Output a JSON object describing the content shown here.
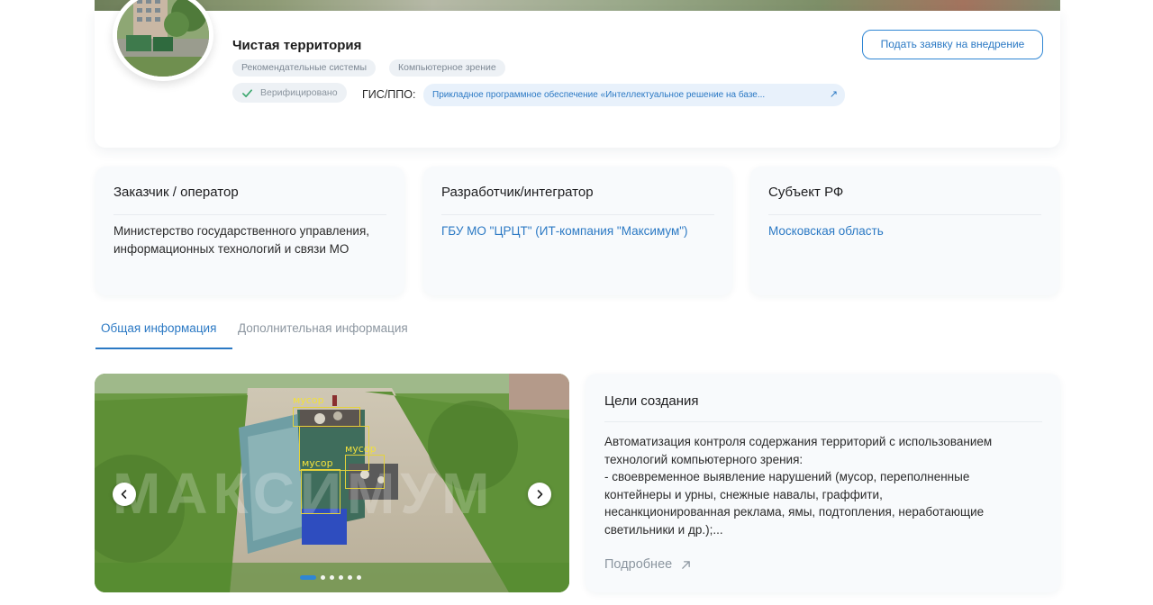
{
  "project": {
    "title": "Чистая территория",
    "tags": [
      "Рекомендательные системы",
      "Компьютерное зрение"
    ],
    "verified_label": "Верифицировано",
    "gis_label": "ГИС/ППО:",
    "gis_link_text": "Прикладное программное обеспечение «Интеллектуальное решение на базе...",
    "apply_button": "Подать заявку на внедрение"
  },
  "info_cards": [
    {
      "heading": "Заказчик / оператор",
      "body": "Министерство государственного управления, информационных технологий и связи МО"
    },
    {
      "heading": "Разработчик/интегратор",
      "body": "ГБУ МО \"ЦРЦТ\" (ИТ-компания \"Максимум\")"
    },
    {
      "heading": "Субъект РФ",
      "body": "Московская область"
    }
  ],
  "tabs": [
    {
      "label": "Общая информация",
      "active": true
    },
    {
      "label": "Дополнительная информация",
      "active": false
    }
  ],
  "slider": {
    "watermark": "МАКСИМУМ",
    "detections": [
      "мусор",
      "мусор",
      "мусор"
    ],
    "dot_count": 6,
    "active_dot": 1
  },
  "goals": {
    "heading": "Цели создания",
    "text_lines": [
      "Автоматизация контроля содержания территорий с использованием",
      "технологий компьютерного зрения:",
      "- своевременное выявление нарушений (мусор, переполненные",
      "контейнеры и урны, снежные навалы, граффити,",
      "несанкционированная реклама, ямы, подтопления, неработающие",
      "светильники и др.);..."
    ],
    "more_label": "Подробнее"
  },
  "colors": {
    "accent": "#2b79c4",
    "muted": "#8c96a0",
    "card_bg": "#f8fafc",
    "tag_bg": "#edf1f5",
    "detection": "#e4d23a"
  },
  "icons": {
    "verified": "check-icon",
    "gis_link": "arrow-up-right-icon",
    "prev": "chevron-left-icon",
    "next": "chevron-right-icon",
    "more": "arrow-up-right-icon"
  }
}
